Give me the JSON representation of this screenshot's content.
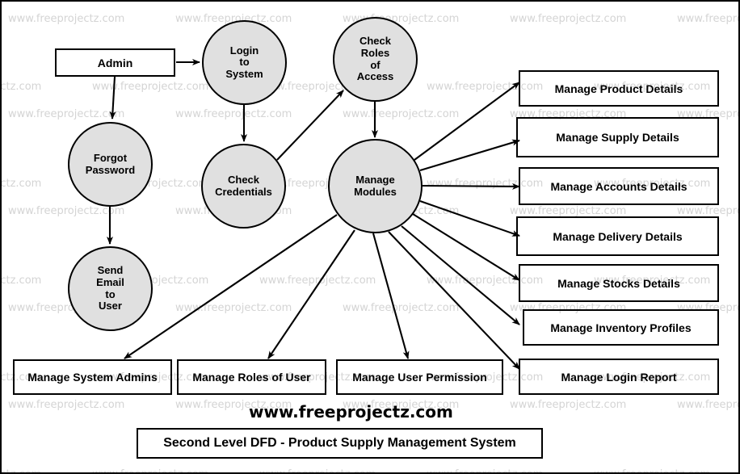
{
  "diagram": {
    "title": "Second Level DFD - Product Supply Management System",
    "brand": "www.freeprojectz.com",
    "watermark_text": "www.freeprojectz.com",
    "colors": {
      "process_fill": "#e0e0e0",
      "stroke": "#000000",
      "background": "#ffffff",
      "watermark": "#d4d4d4"
    }
  },
  "entities": [
    {
      "id": "admin",
      "label": "Admin",
      "shape": "rectangle"
    }
  ],
  "processes": [
    {
      "id": "login_to_system",
      "shape": "circle",
      "lines": [
        "Login",
        "to",
        "System"
      ]
    },
    {
      "id": "check_roles",
      "shape": "circle",
      "lines": [
        "Check",
        "Roles",
        "of",
        "Access"
      ]
    },
    {
      "id": "forgot_password",
      "shape": "circle",
      "lines": [
        "Forgot",
        "Password"
      ]
    },
    {
      "id": "check_credentials",
      "shape": "circle",
      "lines": [
        "Check",
        "Credentials"
      ]
    },
    {
      "id": "send_email",
      "shape": "circle",
      "lines": [
        "Send",
        "Email",
        "to",
        "User"
      ]
    },
    {
      "id": "manage_modules",
      "shape": "circle",
      "lines": [
        "Manage",
        "Modules"
      ]
    }
  ],
  "datastores_right": [
    {
      "id": "product",
      "label": "Manage Product Details"
    },
    {
      "id": "supply",
      "label": "Manage Supply Details"
    },
    {
      "id": "accounts",
      "label": "Manage Accounts Details"
    },
    {
      "id": "delivery",
      "label": "Manage Delivery Details"
    },
    {
      "id": "stocks",
      "label": "Manage Stocks Details"
    },
    {
      "id": "inventory",
      "label": "Manage Inventory Profiles"
    },
    {
      "id": "login_rep",
      "label": "Manage Login Report"
    }
  ],
  "datastores_bottom": [
    {
      "id": "system_admins",
      "label": "Manage System Admins"
    },
    {
      "id": "roles_of_user",
      "label": "Manage Roles of User"
    },
    {
      "id": "user_permission",
      "label": "Manage User Permission"
    }
  ],
  "flows": [
    {
      "from": "admin",
      "to": "login_to_system"
    },
    {
      "from": "admin",
      "to": "forgot_password"
    },
    {
      "from": "forgot_password",
      "to": "send_email"
    },
    {
      "from": "login_to_system",
      "to": "check_credentials"
    },
    {
      "from": "check_credentials",
      "to": "check_roles"
    },
    {
      "from": "check_roles",
      "to": "manage_modules"
    },
    {
      "from": "manage_modules",
      "to": "product"
    },
    {
      "from": "manage_modules",
      "to": "supply"
    },
    {
      "from": "manage_modules",
      "to": "accounts"
    },
    {
      "from": "manage_modules",
      "to": "delivery"
    },
    {
      "from": "manage_modules",
      "to": "stocks"
    },
    {
      "from": "manage_modules",
      "to": "inventory"
    },
    {
      "from": "manage_modules",
      "to": "login_rep"
    },
    {
      "from": "manage_modules",
      "to": "system_admins"
    },
    {
      "from": "manage_modules",
      "to": "roles_of_user"
    },
    {
      "from": "manage_modules",
      "to": "user_permission"
    }
  ]
}
